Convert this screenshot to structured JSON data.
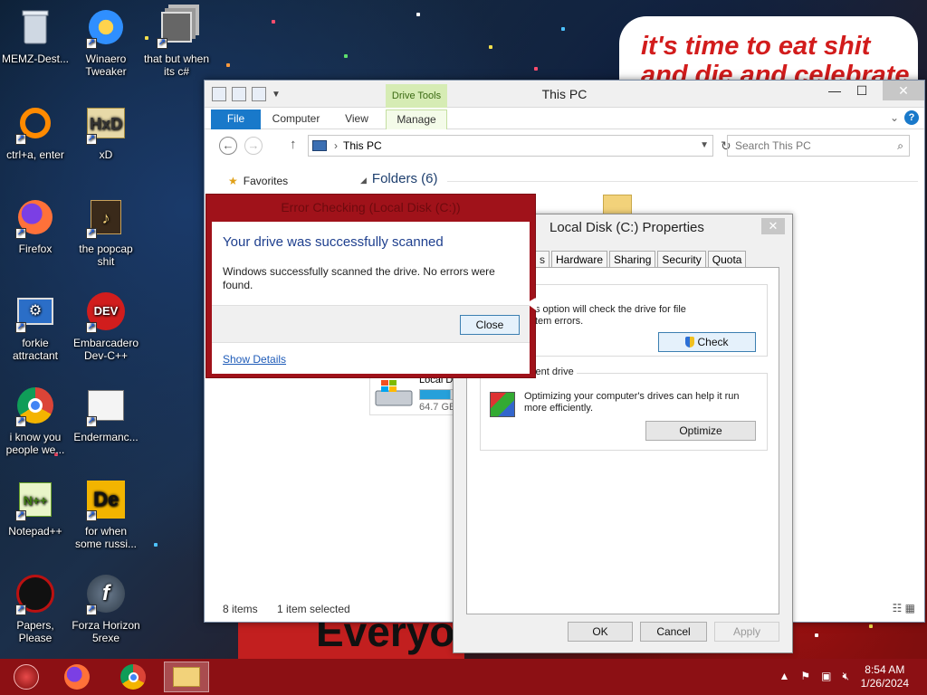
{
  "desktop": {
    "icons": [
      {
        "label": "MEMZ-Dest...",
        "icon": "recycle-bin-icon"
      },
      {
        "label": "Winaero Tweaker",
        "icon": "winaero-icon"
      },
      {
        "label": "that but when its c#",
        "icon": "stacked-windows-icon"
      },
      {
        "label": "ctrl+a, enter",
        "icon": "orange-ring-icon"
      },
      {
        "label": "xD",
        "icon": "hxd-icon"
      },
      {
        "label": "Firefox",
        "icon": "firefox-icon"
      },
      {
        "label": "the popcap shit",
        "icon": "popcap-icon"
      },
      {
        "label": "forkie attractant",
        "icon": "monitor-gear-icon"
      },
      {
        "label": "Embarcadero Dev-C++",
        "icon": "devcpp-icon"
      },
      {
        "label": "i know you people we...",
        "icon": "chrome-icon"
      },
      {
        "label": "Endermanc...",
        "icon": "document-window-icon"
      },
      {
        "label": "Notepad++",
        "icon": "notepadpp-icon"
      },
      {
        "label": "for when some russi...",
        "icon": "de-icon"
      },
      {
        "label": "Papers, Please",
        "icon": "papers-please-icon"
      },
      {
        "label": "Forza Horizon 5rexe",
        "icon": "flash-icon"
      }
    ],
    "banner_text": "it's time to eat shit",
    "banner_text_2": "and die and celebrate",
    "poster_text": "Everyo"
  },
  "explorer": {
    "title": "This PC",
    "context_tab": "Drive Tools",
    "tabs": [
      "File",
      "Computer",
      "View",
      "Manage"
    ],
    "address": "This PC",
    "search_placeholder": "Search This PC",
    "nav_favorites": "Favorites",
    "folders_header": "Folders (6)",
    "drive_name": "Local D",
    "drive_size": "64.7 GB",
    "drive_fill": 0.8,
    "status_items": "8 items",
    "status_selected": "1 item selected"
  },
  "properties": {
    "title": "Local Disk (C:) Properties",
    "tabs": [
      "s",
      "Hardware",
      "Sharing",
      "Security",
      "Quota"
    ],
    "error_group_title": "ing",
    "error_text_1": "s option will check the drive for file",
    "error_text_2": "tem errors.",
    "check_label": "Check",
    "defrag_group_title": "d defragment drive",
    "defrag_text_1": "Optimizing your computer's drives can help it run",
    "defrag_text_2": "more efficiently.",
    "optimize_label": "Optimize",
    "ok_label": "OK",
    "cancel_label": "Cancel",
    "apply_label": "Apply"
  },
  "checkdisk": {
    "outer_title": "Error Checking (Local Disk (C:))",
    "heading": "Your drive was successfully scanned",
    "message": "Windows successfully scanned the drive. No errors were found.",
    "close_label": "Close",
    "details_link": "Show Details"
  },
  "taskbar": {
    "time": "8:54 AM",
    "date": "1/26/2024"
  },
  "colors": {
    "accent": "#1979ca",
    "taskbar": "#8c1014",
    "dialog_border": "#a0121a",
    "heading_blue": "#1e3f8e"
  }
}
